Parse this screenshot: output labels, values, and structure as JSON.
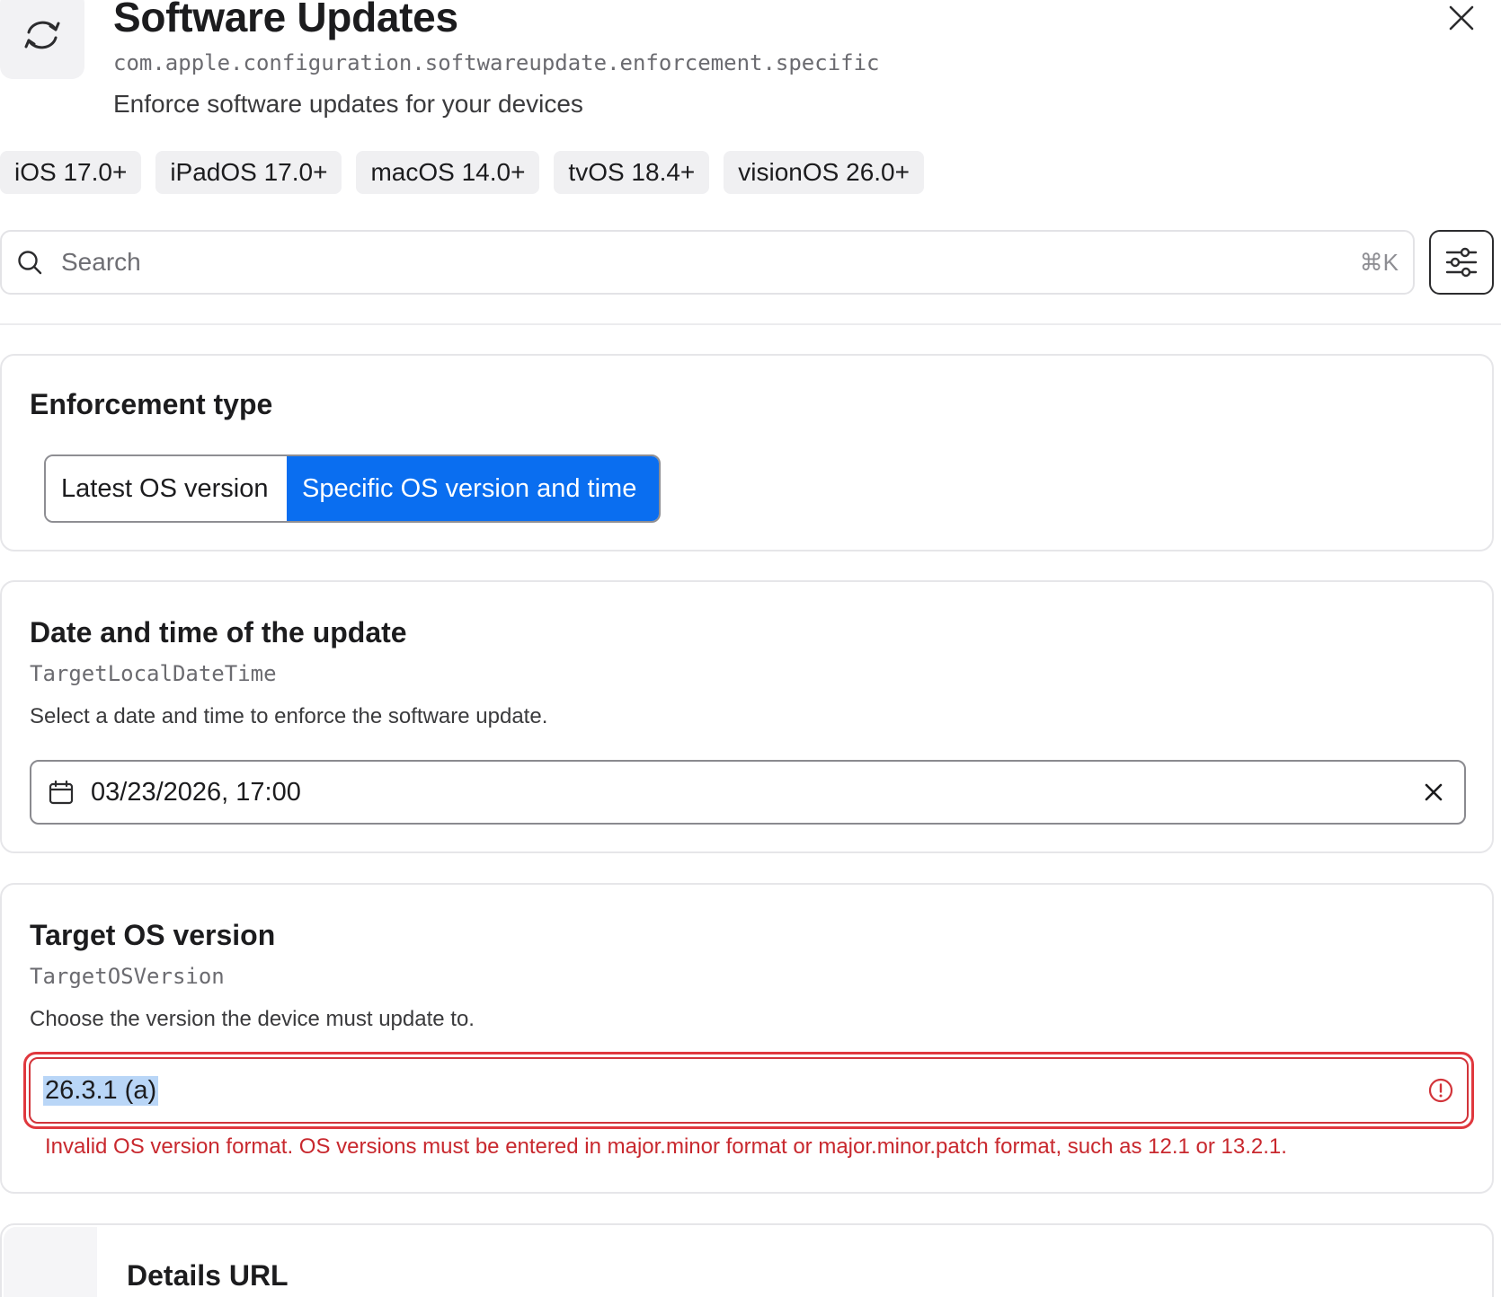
{
  "header": {
    "title": "Software Updates",
    "identifier": "com.apple.configuration.softwareupdate.enforcement.specific",
    "subtitle": "Enforce software updates for your devices",
    "app_icon": "sync-arrows-icon",
    "close_icon": "close-icon"
  },
  "platforms": [
    "iOS 17.0+",
    "iPadOS 17.0+",
    "macOS 14.0+",
    "tvOS 18.4+",
    "visionOS 26.0+"
  ],
  "search": {
    "placeholder": "Search",
    "shortcut": "⌘K",
    "icon": "search-icon",
    "filter_icon": "sliders-icon"
  },
  "enforcement": {
    "title": "Enforcement type",
    "options": [
      "Latest OS version",
      "Specific OS version and time"
    ],
    "selected": "Specific OS version and time",
    "selected_color": "#0a6ef0"
  },
  "datetime": {
    "title": "Date and time of the update",
    "key": "TargetLocalDateTime",
    "description": "Select a date and time to enforce the software update.",
    "value": "03/23/2026, 17:00",
    "icon": "calendar-icon",
    "clear_icon": "clear-x-icon"
  },
  "target_os": {
    "title": "Target OS version",
    "key": "TargetOSVersion",
    "description": "Choose the version the device must update to.",
    "value": "26.3.1 (a)",
    "error_icon": "alert-circle-icon",
    "error_color": "#c8282e",
    "error": "Invalid OS version format. OS versions must be entered in major.minor format or major.minor.patch format, such as 12.1 or 13.2.1."
  },
  "details_url": {
    "title": "Details URL"
  }
}
